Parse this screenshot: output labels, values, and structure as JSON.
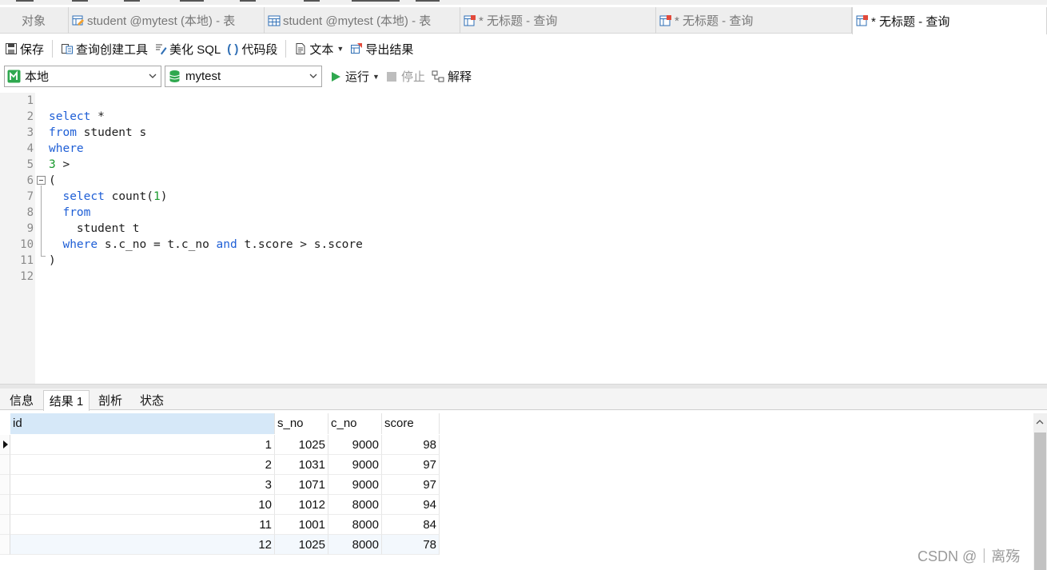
{
  "tabs": [
    {
      "label": "对象",
      "icon": "",
      "active": false
    },
    {
      "label": "student @mytest (本地) - 表",
      "icon": "table-design-icon",
      "active": false
    },
    {
      "label": "student @mytest (本地) - 表",
      "icon": "table-icon",
      "active": false
    },
    {
      "label": "* 无标题 - 查询",
      "icon": "query-icon",
      "active": false
    },
    {
      "label": "* 无标题 - 查询",
      "icon": "query-icon",
      "active": false
    },
    {
      "label": "* 无标题 - 查询",
      "icon": "query-icon",
      "active": true
    }
  ],
  "toolbar": {
    "save_label": "保存",
    "query_builder_label": "查询创建工具",
    "beautify_label": "美化 SQL",
    "snippet_label": "代码段",
    "text_label": "文本",
    "export_label": "导出结果"
  },
  "connection": {
    "connection_value": "本地",
    "database_value": "mytest",
    "run_label": "运行",
    "stop_label": "停止",
    "explain_label": "解释"
  },
  "editor": {
    "line_numbers": [
      "1",
      "2",
      "3",
      "4",
      "5",
      "6",
      "7",
      "8",
      "9",
      "10",
      "11",
      "12"
    ]
  },
  "result_tabs": [
    "信息",
    "结果 1",
    "剖析",
    "状态"
  ],
  "active_result_tab": "结果 1",
  "grid": {
    "columns": [
      "id",
      "s_no",
      "c_no",
      "score"
    ],
    "rows": [
      [
        "1",
        "1025",
        "9000",
        "98"
      ],
      [
        "2",
        "1031",
        "9000",
        "97"
      ],
      [
        "3",
        "1071",
        "9000",
        "97"
      ],
      [
        "10",
        "1012",
        "8000",
        "94"
      ],
      [
        "11",
        "1001",
        "8000",
        "84"
      ],
      [
        "12",
        "1025",
        "8000",
        "78"
      ]
    ],
    "current_row": 0
  },
  "colors": {
    "keyword": "#1f5fd6",
    "number": "#1a9a2e",
    "selected_header": "#d6e8f8"
  },
  "watermark": "CSDN @｜离殇"
}
